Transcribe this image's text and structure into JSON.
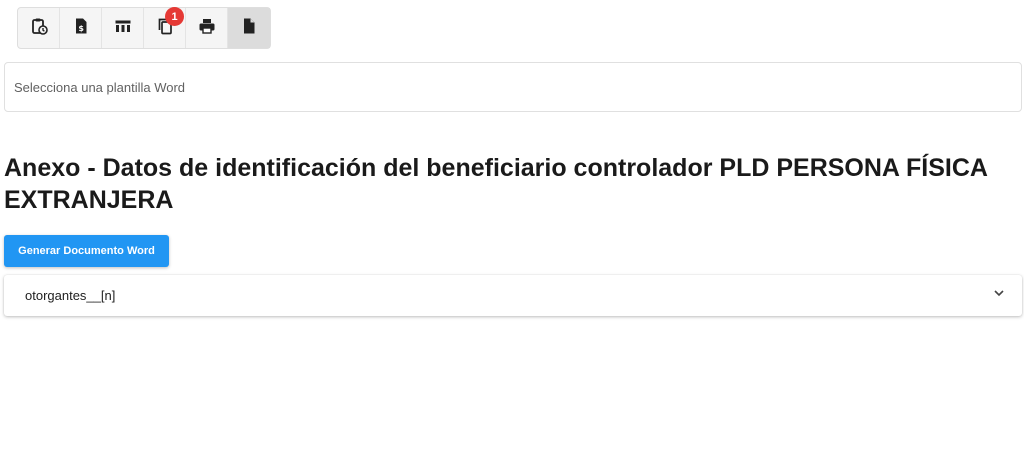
{
  "toolbar": {
    "buttons": [
      {
        "icon": "clipboard-clock-icon"
      },
      {
        "icon": "invoice-dollar-icon"
      },
      {
        "icon": "table-columns-icon"
      },
      {
        "icon": "copy-icon",
        "badge": "1"
      },
      {
        "icon": "print-icon"
      },
      {
        "icon": "document-icon",
        "active": true
      }
    ]
  },
  "template_select": {
    "placeholder": "Selecciona una plantilla Word"
  },
  "page_title": "Anexo - Datos de identificación del beneficiario controlador PLD PERSONA FÍSICA EXTRANJERA",
  "generate_button": {
    "label": "Generar Documento Word"
  },
  "accordion": {
    "label": "otorgantes__[n]"
  },
  "colors": {
    "primary": "#2196f3",
    "badge": "#e53935",
    "toolbar_bg": "#f5f5f5",
    "active_bg": "#dcdcdc"
  }
}
